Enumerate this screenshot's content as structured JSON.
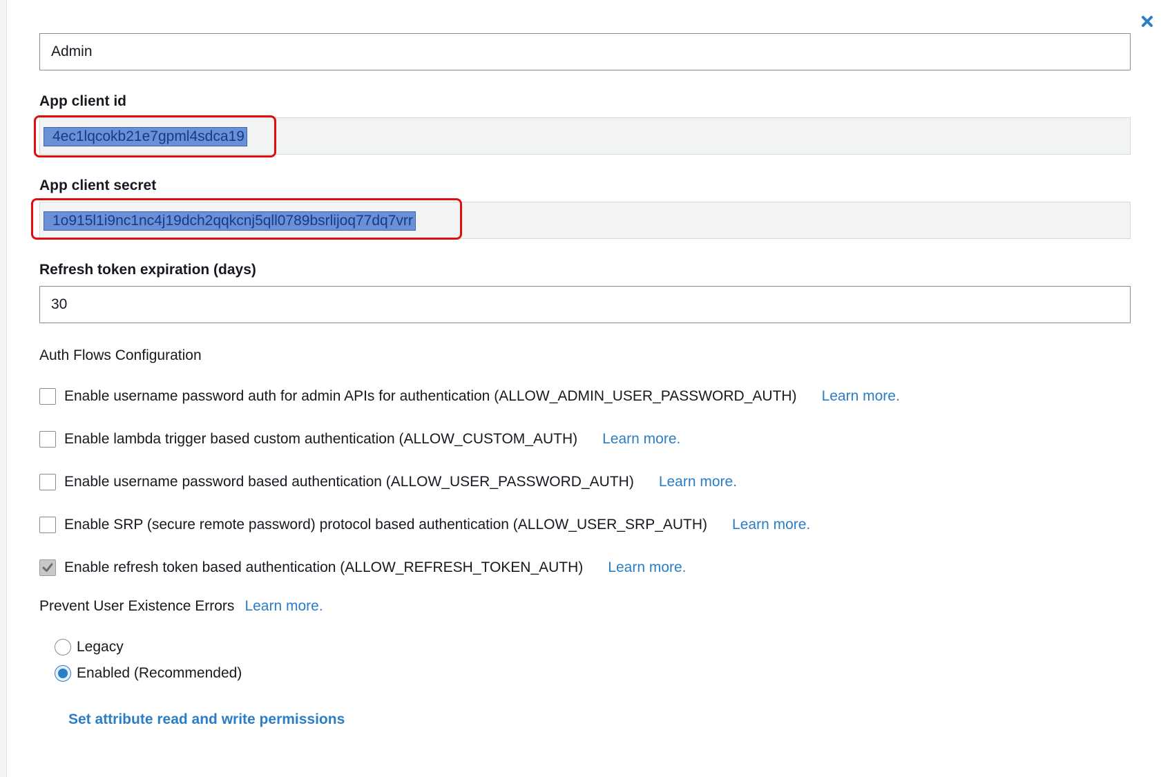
{
  "dialog": {
    "close_icon": "close-icon"
  },
  "form": {
    "app_client_name_value": "Admin",
    "app_client_id": {
      "label": "App client id",
      "value": "4ec1lqcokb21e7gpml4sdca19"
    },
    "app_client_secret": {
      "label": "App client secret",
      "value": "1o915l1i9nc1nc4j19dch2qqkcnj5qll0789bsrlijoq77dq7vrr"
    },
    "refresh_token_expiration": {
      "label": "Refresh token expiration (days)",
      "value": "30"
    }
  },
  "auth_flows": {
    "heading": "Auth Flows Configuration",
    "items": [
      {
        "label": "Enable username password auth for admin APIs for authentication (ALLOW_ADMIN_USER_PASSWORD_AUTH)",
        "checked": false,
        "learn_more": "Learn more."
      },
      {
        "label": "Enable lambda trigger based custom authentication (ALLOW_CUSTOM_AUTH)",
        "checked": false,
        "learn_more": "Learn more."
      },
      {
        "label": "Enable username password based authentication (ALLOW_USER_PASSWORD_AUTH)",
        "checked": false,
        "learn_more": "Learn more."
      },
      {
        "label": "Enable SRP (secure remote password) protocol based authentication (ALLOW_USER_SRP_AUTH)",
        "checked": false,
        "learn_more": "Learn more."
      },
      {
        "label": "Enable refresh token based authentication (ALLOW_REFRESH_TOKEN_AUTH)",
        "checked": true,
        "learn_more": "Learn more."
      }
    ]
  },
  "prevent_user_existence_errors": {
    "label": "Prevent User Existence Errors",
    "learn_more": "Learn more.",
    "options": [
      {
        "label": "Legacy",
        "selected": false
      },
      {
        "label": "Enabled (Recommended)",
        "selected": true
      }
    ]
  },
  "permissions_link": "Set attribute read and write permissions",
  "colors": {
    "link": "#2a7dc6",
    "highlight_ring": "#e00d0d",
    "selection": "#6a90d6"
  }
}
